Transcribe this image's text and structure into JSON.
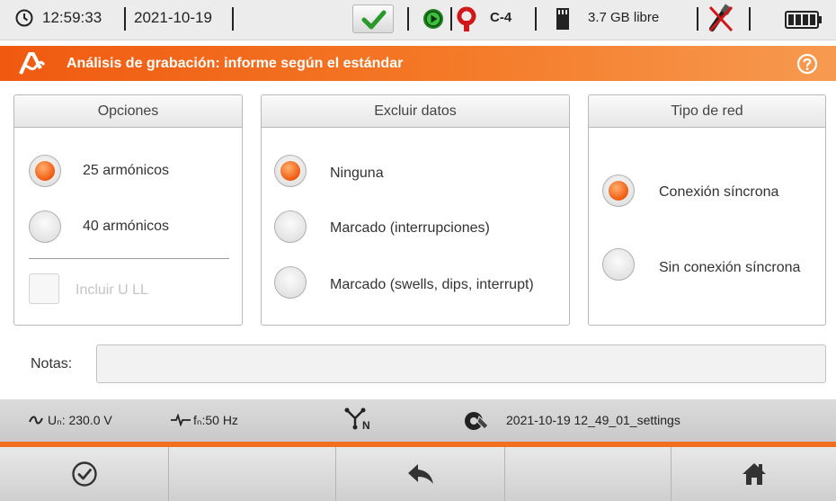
{
  "statusbar": {
    "time": "12:59:33",
    "date": "2021-10-19",
    "clamp": "C-4",
    "storage": "3.7 GB libre"
  },
  "titlebar": {
    "title": "Análisis de grabación: informe según el estándar"
  },
  "panels": {
    "opciones": {
      "title": "Opciones",
      "options": [
        {
          "label": "25 armónicos",
          "selected": true
        },
        {
          "label": "40 armónicos",
          "selected": false
        }
      ],
      "checkbox": {
        "label": "Incluir U LL",
        "checked": false,
        "enabled": false
      }
    },
    "excluir": {
      "title": "Excluir datos",
      "options": [
        {
          "label": "Ninguna",
          "selected": true
        },
        {
          "label": "Marcado (interrupciones)",
          "selected": false
        },
        {
          "label": "Marcado (swells, dips, interrupt)",
          "selected": false
        }
      ]
    },
    "tipo_red": {
      "title": "Tipo de red",
      "options": [
        {
          "label": "Conexión síncrona",
          "selected": true
        },
        {
          "label": "Sin conexión síncrona",
          "selected": false
        }
      ]
    }
  },
  "notes": {
    "label": "Notas:",
    "value": ""
  },
  "infobar": {
    "voltage": "Uₙ: 230.0 V",
    "frequency": "fₙ:50 Hz",
    "settings_file": "2021-10-19 12_49_01_settings"
  },
  "bottom_buttons": [
    "confirm-icon",
    "",
    "back-icon",
    "",
    "home-icon"
  ],
  "colors": {
    "accent": "#f05a10",
    "ok_green": "#2a9a2a"
  }
}
